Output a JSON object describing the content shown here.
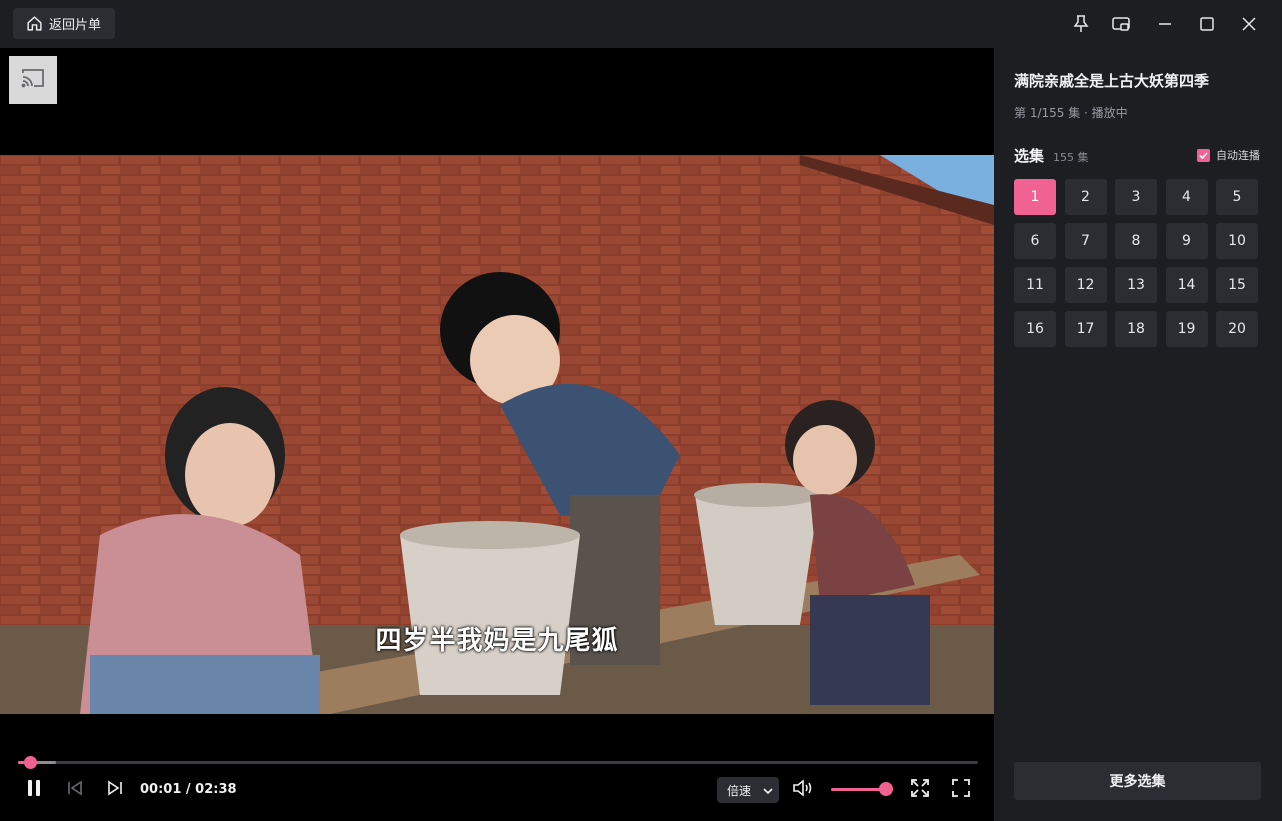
{
  "titlebar": {
    "back_label": "返回片单",
    "icons": [
      "home-icon",
      "pin-icon",
      "picture-in-picture-icon",
      "minimize-icon",
      "maximize-icon",
      "close-icon"
    ]
  },
  "player": {
    "subtitle": "四岁半我妈是九尾狐",
    "time": "00:01 / 02:38",
    "progress_fraction": 0.013,
    "buffered_fraction": 0.04,
    "volume_fraction": 1.0,
    "speed_label": "倍速",
    "accent_color": "#f06292"
  },
  "sidebar": {
    "show_title": "满院亲戚全是上古大妖第四季",
    "status": "第 1/155 集 · 播放中",
    "episodes_header": "选集",
    "episodes_count": "155 集",
    "autoplay_label": "自动连播",
    "autoplay_checked": true,
    "current_episode": "1",
    "episodes": [
      "1",
      "2",
      "3",
      "4",
      "5",
      "6",
      "7",
      "8",
      "9",
      "10",
      "11",
      "12",
      "13",
      "14",
      "15",
      "16",
      "17",
      "18",
      "19",
      "20"
    ],
    "more_label": "更多选集"
  }
}
